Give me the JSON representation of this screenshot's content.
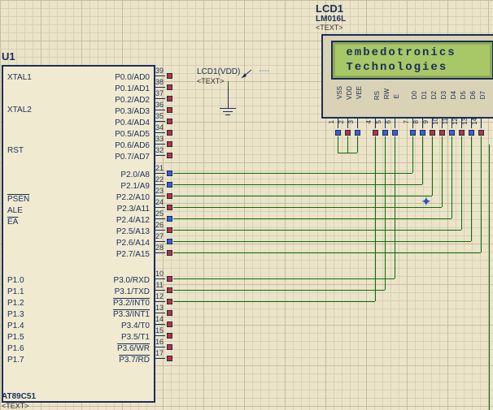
{
  "u1": {
    "ref": "U1",
    "part": "AT89C51",
    "textTag": "<TEXT>",
    "leftPins": {
      "XTAL1": "XTAL1",
      "XTAL2": "XTAL2",
      "RST": "RST",
      "PSEN": "PSEN",
      "ALE": "ALE",
      "EA": "EA",
      "P10": "P1.0",
      "P11": "P1.1",
      "P12": "P1.2",
      "P13": "P1.3",
      "P14": "P1.4",
      "P15": "P1.5",
      "P16": "P1.6",
      "P17": "P1.7"
    },
    "rightPins": {
      "P00": "P0.0/AD0",
      "P01": "P0.1/AD1",
      "P02": "P0.2/AD2",
      "P03": "P0.3/AD3",
      "P04": "P0.4/AD4",
      "P05": "P0.5/AD5",
      "P06": "P0.6/AD6",
      "P07": "P0.7/AD7",
      "P20": "P2.0/A8",
      "P21": "P2.1/A9",
      "P22": "P2.2/A10",
      "P23": "P2.3/A11",
      "P24": "P2.4/A12",
      "P25": "P2.5/A13",
      "P26": "P2.6/A14",
      "P27": "P2.7/A15",
      "P30": "P3.0/RXD",
      "P31": "P3.1/TXD",
      "P32": "P3.2/INT0",
      "P33": "P3.3/INT1",
      "P34": "P3.4/T0",
      "P35": "P3.5/T1",
      "P36": "P3.6/WR",
      "P37": "P3.7/RD"
    },
    "pinNums": {
      "n39": "39",
      "n38": "38",
      "n37": "37",
      "n36": "36",
      "n35": "35",
      "n34": "34",
      "n33": "33",
      "n32": "32",
      "n21": "21",
      "n22": "22",
      "n23": "23",
      "n24": "24",
      "n25": "25",
      "n26": "26",
      "n27": "27",
      "n28": "28",
      "n10": "10",
      "n11": "11",
      "n12": "12",
      "n13": "13",
      "n14": "14",
      "n15": "15",
      "n16": "16",
      "n17": "17"
    }
  },
  "lcd": {
    "ref": "LCD1",
    "part": "LM016L",
    "textTag": "<TEXT>",
    "line1": " embedotronics",
    "line2": " Technologies",
    "pins": {
      "VSS": "VSS",
      "VDD": "VDD",
      "VEE": "VEE",
      "RS": "RS",
      "RW": "RW",
      "E": "E",
      "D0": "D0",
      "D1": "D1",
      "D2": "D2",
      "D3": "D3",
      "D4": "D4",
      "D5": "D5",
      "D6": "D6",
      "D7": "D7"
    },
    "pinNums": {
      "p1": "1",
      "p2": "2",
      "p3": "3",
      "p4": "4",
      "p5": "5",
      "p6": "6",
      "p7": "7",
      "p8": "8",
      "p9": "9",
      "p10": "10",
      "p11": "11",
      "p12": "12",
      "p13": "13",
      "p14": "14"
    }
  },
  "probe": {
    "label": "LCD1(VDD)",
    "textTag": "<TEXT>"
  },
  "power": {
    "label": "----"
  }
}
